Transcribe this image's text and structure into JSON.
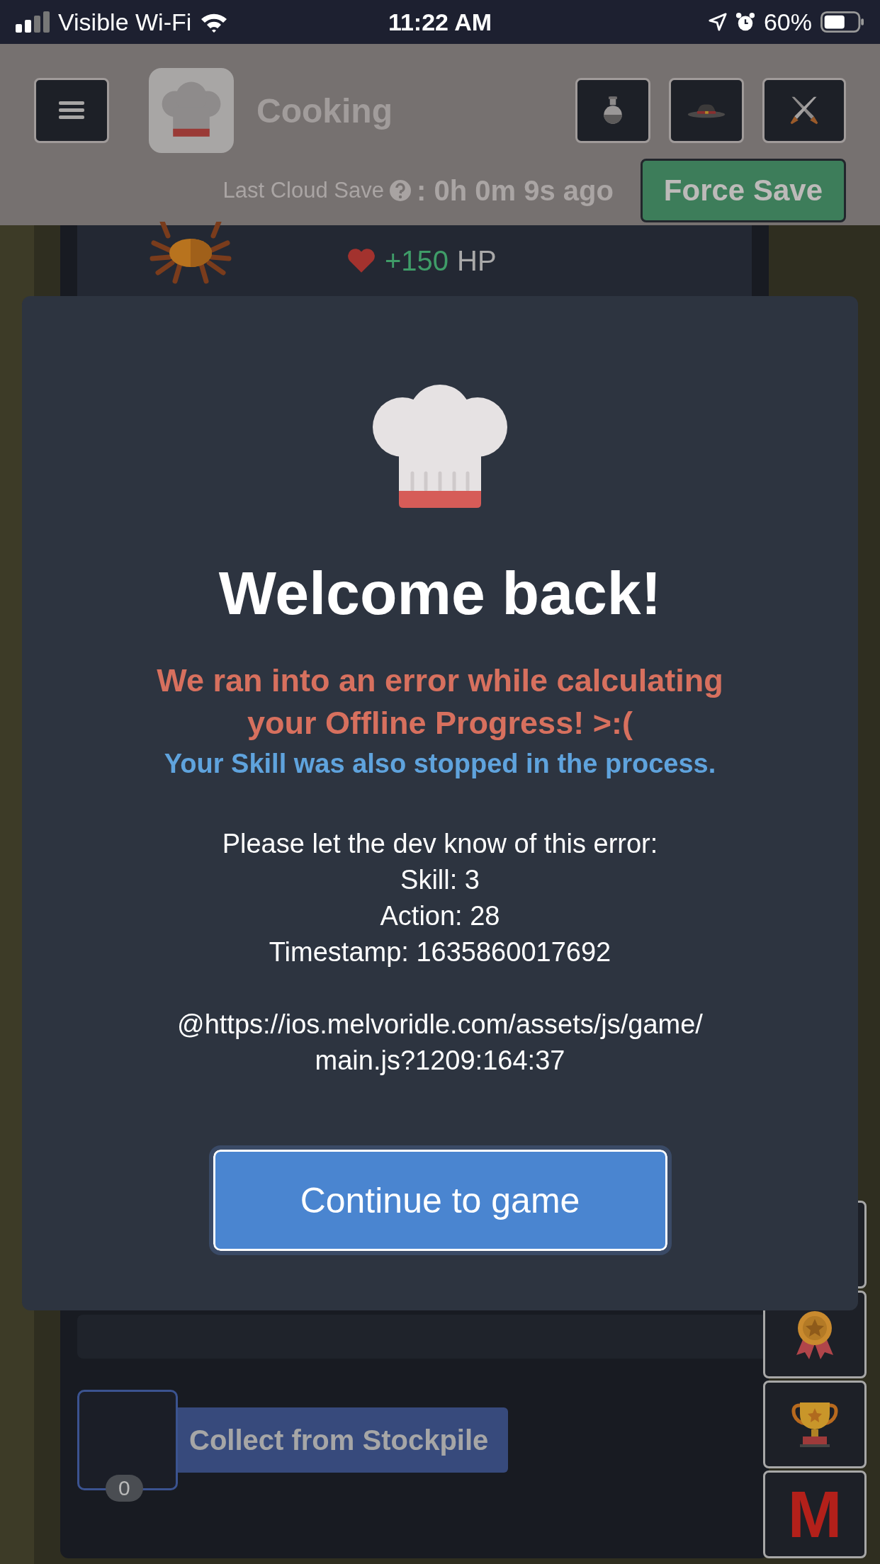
{
  "status_bar": {
    "carrier": "Visible Wi-Fi",
    "time": "11:22 AM",
    "battery": "60%"
  },
  "header": {
    "title": "Cooking",
    "cloud_save_label": "Last Cloud Save",
    "cloud_save_value": ": 0h 0m 9s ago",
    "force_save": "Force Save"
  },
  "food_card": {
    "heal": "+150",
    "unit": "HP"
  },
  "modal": {
    "title": "Welcome back!",
    "error": "We ran into an error while calculating your Offline Progress! >:(",
    "skill_note": "Your Skill was also stopped in the process.",
    "details": [
      "Please let the dev know of this error:",
      "Skill: 3",
      "Action: 28",
      "Timestamp: 1635860017692"
    ],
    "trace_lines": [
      "@https://ios.melvoridle.com/assets/js/game/",
      "main.js?1209:164:37"
    ],
    "button": "Continue to game"
  },
  "stockpile": {
    "count": "0",
    "button": "Collect from Stockpile"
  },
  "side_logo": "M"
}
